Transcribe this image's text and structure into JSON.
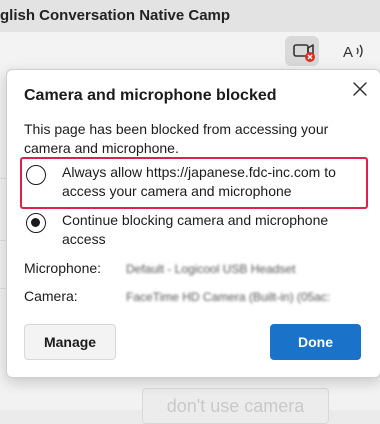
{
  "browser": {
    "tab_title": "glish Conversation Native Camp",
    "camera_indicator_icon": "camera-blocked-icon",
    "read_aloud_icon": "read-aloud-icon"
  },
  "page_behind": {
    "button_text": "don't use camera"
  },
  "popup": {
    "title": "Camera and microphone blocked",
    "description": "This page has been blocked from accessing your camera and microphone.",
    "options": [
      {
        "label": "Always allow https://japanese.fdc-inc.com to access your camera and microphone",
        "selected": false
      },
      {
        "label": "Continue blocking camera and microphone access",
        "selected": true
      }
    ],
    "devices": {
      "microphone_label": "Microphone:",
      "microphone_value": "Default - Logicool USB Headset",
      "camera_label": "Camera:",
      "camera_value": "FaceTime HD Camera (Built-in) (05ac:"
    },
    "manage_label": "Manage",
    "done_label": "Done"
  },
  "colors": {
    "accent": "#1a73c9",
    "highlight": "#e0204c",
    "blocked_badge": "#d93025"
  }
}
